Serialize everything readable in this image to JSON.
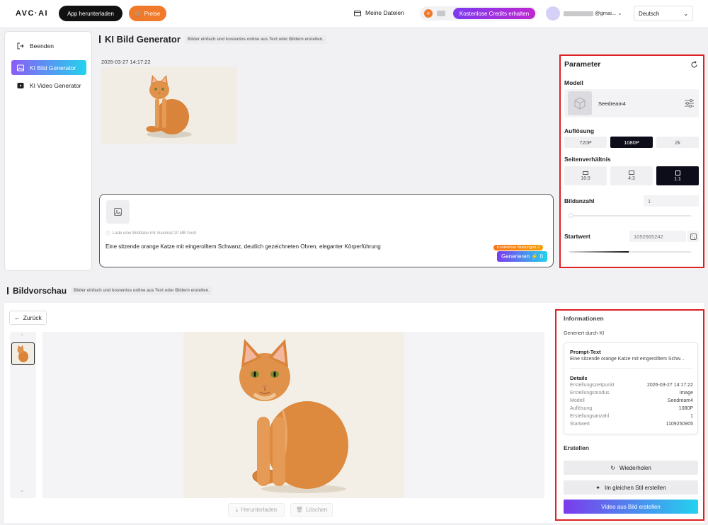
{
  "topbar": {
    "logo": "AVC·AI",
    "download_app": "App herunterladen",
    "prices": "Preise",
    "my_files": "Meine Dateien",
    "credits_button": "Kostenlose Credits erhalten",
    "email_suffix": "@gmai...",
    "language": "Deutsch"
  },
  "sidebar": {
    "items": [
      {
        "label": "Beenden"
      },
      {
        "label": "KI Bild Generator"
      },
      {
        "label": "KI Video Generator"
      }
    ]
  },
  "generator": {
    "title": "KI Bild Generator",
    "subtitle": "Bilder einfach und kostenlos online aus Text oder Bildern erstellen.",
    "timestamp": "2026-03-27 14:17:22",
    "upload_hint": "Lade eine Bilddatei mit maximal 10 MB hoch",
    "prompt_text": "Eine sitzende orange Katze mit eingerolltem Schwanz, deutlich gezeichneten Ohren, eleganter Körperführung",
    "free_uses_badge": "Kostenlose Nutzungen",
    "free_uses_count": "2",
    "generate_label": "Generieren",
    "generate_cost": "0"
  },
  "parameters": {
    "title": "Parameter",
    "model_label": "Modell",
    "model_name": "Seedream4",
    "resolution_label": "Auflösung",
    "resolutions": [
      "720P",
      "1080P",
      "2k"
    ],
    "resolution_selected": "1080P",
    "aspect_label": "Seitenverhältnis",
    "aspects": [
      "16:9",
      "4:3",
      "1:1"
    ],
    "aspect_selected": "1:1",
    "count_label": "Bildanzahl",
    "count_value": "1",
    "seed_label": "Startwert",
    "seed_value": "1052665242"
  },
  "preview": {
    "title": "Bildvorschau",
    "subtitle": "Bilder einfach und kostenlos online aus Text oder Bildern erstellen.",
    "back_label": "Zurück",
    "download_label": "Herunterladen",
    "delete_label": "Löschen"
  },
  "info": {
    "title": "Informationen",
    "generated_by": "Generiert durch KI",
    "prompt_heading": "Prompt-Text",
    "prompt_excerpt": "Eine sitzende orange Katze mit eingerolltem Schw...",
    "details_heading": "Details",
    "details": [
      {
        "k": "Erstellungszeitpunkt",
        "v": "2026-03-27 14:17:22"
      },
      {
        "k": "Erstellungsmodus",
        "v": "image"
      },
      {
        "k": "Modell",
        "v": "Seedream4"
      },
      {
        "k": "Auflösung",
        "v": "1080P"
      },
      {
        "k": "Erstellungsanzahl",
        "v": "1"
      },
      {
        "k": "Startwert",
        "v": "1109250905"
      }
    ],
    "create_heading": "Erstellen",
    "repeat_label": "Wiederholen",
    "same_style_label": "Im gleichen Stil erstellen",
    "video_label": "Video aus Bild erstellen"
  }
}
